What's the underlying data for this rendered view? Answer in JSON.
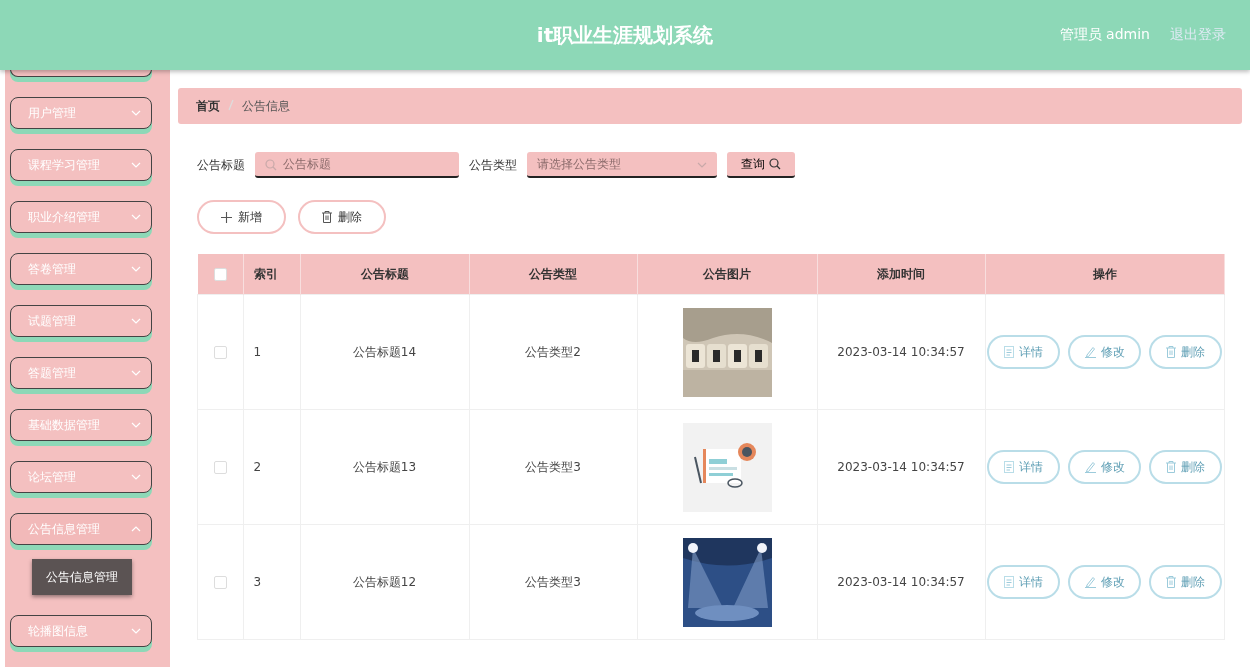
{
  "header": {
    "title": "it职业生涯规划系统",
    "user": "管理员 admin",
    "logout": "退出登录"
  },
  "sidebar": {
    "items": [
      {
        "label": "用户管理",
        "expanded": false
      },
      {
        "label": "课程学习管理",
        "expanded": false
      },
      {
        "label": "职业介绍管理",
        "expanded": false
      },
      {
        "label": "答卷管理",
        "expanded": false
      },
      {
        "label": "试题管理",
        "expanded": false
      },
      {
        "label": "答题管理",
        "expanded": false
      },
      {
        "label": "基础数据管理",
        "expanded": false
      },
      {
        "label": "论坛管理",
        "expanded": false
      },
      {
        "label": "公告信息管理",
        "expanded": true,
        "children": [
          {
            "label": "公告信息管理"
          }
        ]
      },
      {
        "label": "轮播图信息",
        "expanded": false
      }
    ]
  },
  "breadcrumb": [
    "首页",
    "公告信息"
  ],
  "search": {
    "title_label": "公告标题",
    "title_placeholder": "公告标题",
    "type_label": "公告类型",
    "type_placeholder": "请选择公告类型",
    "query_button": "查询"
  },
  "actions": [
    "新增",
    "删除"
  ],
  "table": {
    "columns": [
      "索引",
      "公告标题",
      "公告类型",
      "公告图片",
      "添加时间",
      "操作"
    ],
    "header_checked": false,
    "rows": [
      {
        "index": "1",
        "title": "公告标题14",
        "type": "公告类型2",
        "time": "2023-03-14 10:34:57",
        "checked": false,
        "buttons": [
          "详情",
          "修改",
          "删除"
        ]
      },
      {
        "index": "2",
        "title": "公告标题13",
        "type": "公告类型3",
        "time": "2023-03-14 10:34:57",
        "checked": false,
        "buttons": [
          "详情",
          "修改",
          "删除"
        ]
      },
      {
        "index": "3",
        "title": "公告标题12",
        "type": "公告类型3",
        "time": "2023-03-14 10:34:57",
        "checked": false,
        "buttons": [
          "详情",
          "修改",
          "删除"
        ]
      }
    ]
  }
}
